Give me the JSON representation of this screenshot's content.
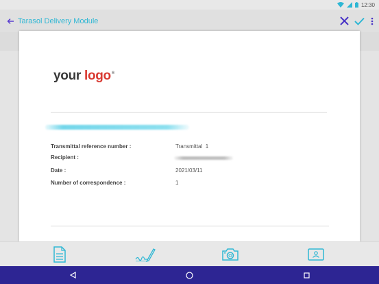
{
  "status_bar": {
    "time": "12:30"
  },
  "app_bar": {
    "title": "Tarasol Delivery Module",
    "back_icon": "arrow-left-icon",
    "actions": [
      "close-icon",
      "check-icon",
      "more-vert-icon"
    ],
    "accent": "#5b3fd0",
    "title_color": "#2fb7d4"
  },
  "document": {
    "logo": {
      "word1": "your",
      "word2": "logo",
      "mark": "®"
    },
    "fields": [
      {
        "label": "Transmittal reference number :",
        "value": "Transmittal  1"
      },
      {
        "label": "Recipient :",
        "value": ""
      },
      {
        "label": "Date :",
        "value": "2021/03/11"
      },
      {
        "label": "Number of correspondence :",
        "value": "1"
      }
    ]
  },
  "toolbar": {
    "tools": [
      "document-icon",
      "signature-pen-icon",
      "camera-icon",
      "id-card-icon"
    ],
    "icon_color": "#2fb7d4"
  },
  "nav_bar": {
    "buttons": [
      "back-triangle-icon",
      "home-circle-icon",
      "recents-square-icon"
    ],
    "background": "#2d2593"
  }
}
